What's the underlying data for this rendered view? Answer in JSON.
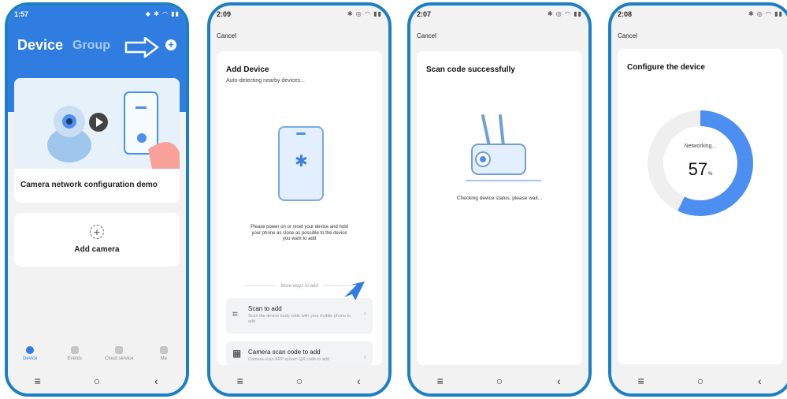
{
  "colors": {
    "accent": "#2f7de1",
    "frame": "#1b7fc6",
    "progress": "#4d8ff0"
  },
  "screens": [
    {
      "status_time": "1:57",
      "header": {
        "tab_device": "Device",
        "tab_group": "Group"
      },
      "demo_title": "Camera network configuration demo",
      "add_camera_label": "Add camera",
      "tabs": [
        {
          "label": "Device",
          "icon": "device-icon"
        },
        {
          "label": "Events",
          "icon": "events-icon"
        },
        {
          "label": "Cloud service",
          "icon": "cloud-icon"
        },
        {
          "label": "Me",
          "icon": "person-icon"
        }
      ]
    },
    {
      "status_time": "2:09",
      "cancel": "Cancel",
      "title": "Add Device",
      "subtitle": "Auto-detecting nearby devices...",
      "instruction": "Please power on or reset your device and hold your phone as close as possible to the device you want to add",
      "more_ways": "More ways to add",
      "options": [
        {
          "title": "Scan to add",
          "desc": "Scan the device body code with your mobile phone to add"
        },
        {
          "title": "Camera scan code to add",
          "desc": "Camera scan APP screen QR code to add"
        }
      ]
    },
    {
      "status_time": "2:07",
      "cancel": "Cancel",
      "title": "Scan code successfully",
      "status": "Checking device status, please wait..."
    },
    {
      "status_time": "2:08",
      "cancel": "Cancel",
      "title": "Configure the device",
      "networking": "Networking...",
      "progress_value": "57",
      "progress_unit": "%",
      "progress_fraction": 0.57
    }
  ],
  "nav_buttons": {
    "menu": "≡",
    "home": "○",
    "back": "‹"
  }
}
